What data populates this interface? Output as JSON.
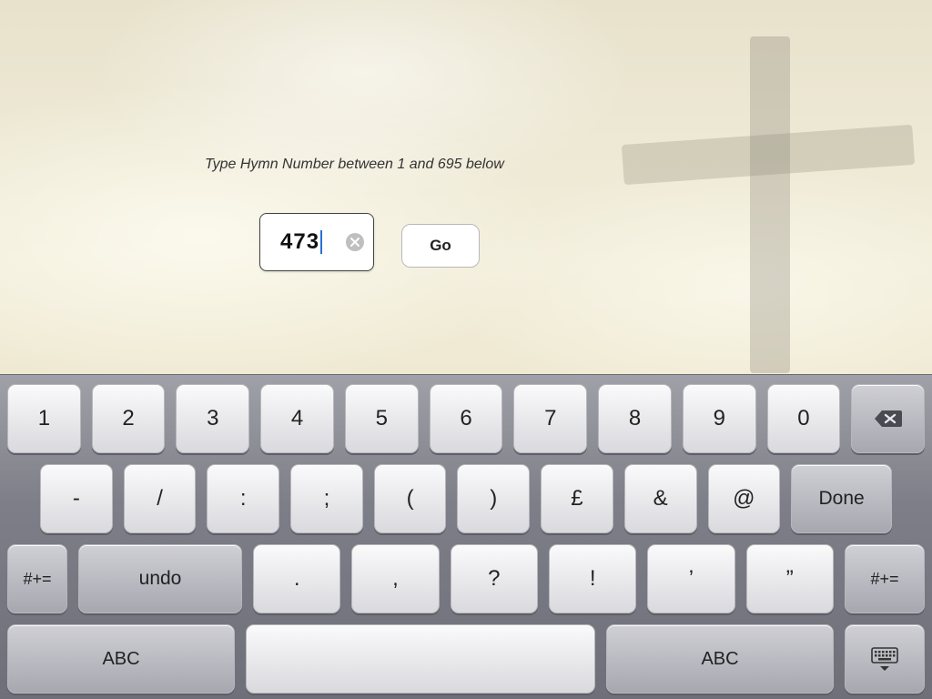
{
  "prompt": "Type Hymn Number between 1 and 695 below",
  "input": {
    "value": "473"
  },
  "go_label": "Go",
  "keyboard": {
    "row1": [
      "1",
      "2",
      "3",
      "4",
      "5",
      "6",
      "7",
      "8",
      "9",
      "0"
    ],
    "row2": [
      "-",
      "/",
      ":",
      ";",
      "(",
      ")",
      "£",
      "&",
      "@"
    ],
    "row2_done": "Done",
    "row3_symleft": "#+=",
    "row3_undo": "undo",
    "row3_punct": [
      ".",
      ",",
      "?",
      "!",
      "’",
      "”"
    ],
    "row3_symright": "#+=",
    "row4_abc": "ABC"
  }
}
